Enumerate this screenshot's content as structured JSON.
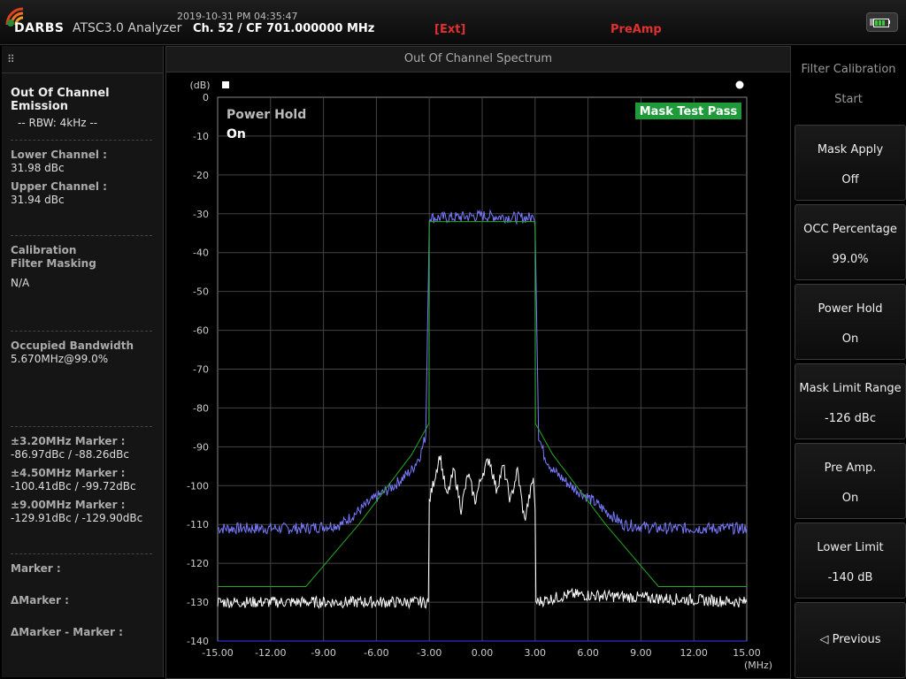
{
  "header": {
    "logo_text": "DARBS",
    "app_title": "ATSC3.0 Analyzer",
    "datetime": "2019-10-31 PM 04:35:47",
    "channel": "Ch. 52 / CF 701.000000 MHz",
    "ext": "[Ext]",
    "preamp": "PreAmp",
    "battery_icon": "battery-charging-icon"
  },
  "left": {
    "title": "Out Of Channel Emission",
    "rbw": "-- RBW: 4kHz --",
    "lower_label": "Lower Channel :",
    "lower_value": "31.98 dBc",
    "upper_label": "Upper Channel :",
    "upper_value": "31.94 dBc",
    "cal_label1": "Calibration",
    "cal_label2": "Filter Masking",
    "cal_value": "N/A",
    "obw_label": "Occupied Bandwidth",
    "obw_value": "5.670MHz@99.0%",
    "m1_label": "±3.20MHz Marker :",
    "m1_value": "-86.97dBc / -88.26dBc",
    "m2_label": "±4.50MHz Marker :",
    "m2_value": "-100.41dBc / -99.72dBc",
    "m3_label": "±9.00MHz Marker :",
    "m3_value": "-129.91dBc / -129.90dBc",
    "marker_label": "Marker :",
    "dmarker_label": "ΔMarker :",
    "dmm_label": "ΔMarker - Marker :"
  },
  "center": {
    "title": "Out Of Channel Spectrum"
  },
  "chart_data": {
    "type": "line",
    "ylabel_unit": "(dB)",
    "xlabel_unit": "(MHz)",
    "xlim": [
      -15,
      15
    ],
    "ylim": [
      -140,
      0
    ],
    "x_ticks": [
      "-15.00",
      "-12.00",
      "-9.00",
      "-6.00",
      "-3.00",
      "0.00",
      "3.00",
      "6.00",
      "9.00",
      "12.00",
      "15.00"
    ],
    "y_ticks": [
      "0",
      "-10",
      "-20",
      "-30",
      "-40",
      "-50",
      "-60",
      "-70",
      "-80",
      "-90",
      "-100",
      "-110",
      "-120",
      "-130",
      "-140"
    ],
    "power_hold_label": "Power Hold",
    "power_hold_value": "On",
    "mask_badge": "Mask Test Pass",
    "grid": true,
    "series": [
      {
        "color": "#7a7aff",
        "x": [
          -15,
          -12,
          -10,
          -8,
          -6,
          -5,
          -4,
          -3.5,
          -3.2,
          -3.0,
          -2.9,
          -2,
          0,
          2,
          2.9,
          3.0,
          3.2,
          3.5,
          4,
          5,
          6,
          8,
          10,
          12,
          15
        ],
        "y": [
          -111,
          -111,
          -111,
          -110,
          -103,
          -100,
          -96,
          -92,
          -87,
          -32,
          -31,
          -31,
          -30.5,
          -31,
          -31,
          -32,
          -87,
          -92,
          -96,
          -100,
          -103,
          -110,
          -111,
          -111,
          -111
        ]
      },
      {
        "color": "#22aa22",
        "x": [
          -15,
          -10,
          -7,
          -4,
          -3.02,
          -3.0,
          3.0,
          3.02,
          4,
          7,
          10,
          15
        ],
        "y": [
          -126,
          -126,
          -110,
          -92,
          -84,
          -32,
          -32,
          -84,
          -92,
          -110,
          -126,
          -126
        ]
      },
      {
        "color": "#ffffff",
        "x": [
          -15,
          -3.05,
          -3.0,
          -2.4,
          -2.0,
          -1.6,
          -1.2,
          -0.8,
          -0.4,
          0,
          0.4,
          0.8,
          1.2,
          1.6,
          2.0,
          2.4,
          2.9,
          3.0,
          3.05,
          5,
          15
        ],
        "y": [
          -130,
          -130,
          -104,
          -92,
          -103,
          -96,
          -106,
          -97,
          -104,
          -97,
          -93,
          -101,
          -95,
          -104,
          -96,
          -109,
          -98,
          -106,
          -130,
          -128,
          -130
        ]
      },
      {
        "color": "#3a3aff",
        "x": [
          -15,
          15
        ],
        "y": [
          -140,
          -140
        ]
      }
    ]
  },
  "right": {
    "filter_cal": "Filter Calibration",
    "filter_cal_start": "Start",
    "buttons": [
      {
        "l1": "Mask Apply",
        "l2": "Off"
      },
      {
        "l1": "OCC Percentage",
        "l2": "99.0%"
      },
      {
        "l1": "Power Hold",
        "l2": "On"
      },
      {
        "l1": "Mask Limit Range",
        "l2": "-126 dBc"
      },
      {
        "l1": "Pre Amp.",
        "l2": "On"
      },
      {
        "l1": "Lower Limit",
        "l2": "-140 dB"
      }
    ],
    "previous": "◁ Previous"
  }
}
